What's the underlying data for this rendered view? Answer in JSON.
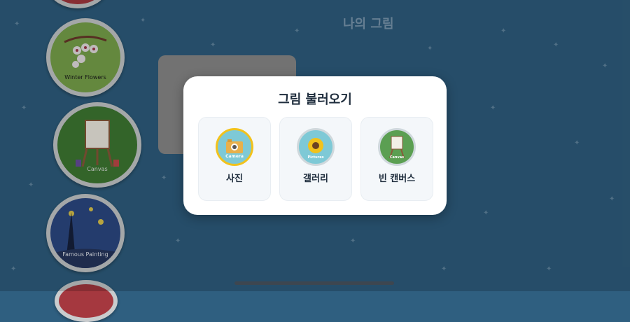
{
  "page": {
    "title": "나의 그림"
  },
  "categories": [
    {
      "label": "Winter Flowers",
      "icon": "winter-flowers-icon"
    },
    {
      "label": "Canvas",
      "icon": "canvas-easel-icon"
    },
    {
      "label": "Famous Painting",
      "icon": "starry-night-icon"
    }
  ],
  "modal": {
    "title": "그림 불러오기",
    "options": [
      {
        "label": "사진",
        "icon_text": "Camera",
        "icon": "camera-icon",
        "ring_color": "#f2c21b",
        "fill_color": "#7ec9d6"
      },
      {
        "label": "갤러리",
        "icon_text": "Pictures",
        "icon": "sunflower-icon",
        "ring_color": "#cfd8dc",
        "fill_color": "#7ec9d6"
      },
      {
        "label": "빈 캔버스",
        "icon_text": "Canvas",
        "icon": "canvas-easel-icon",
        "ring_color": "#cfd8dc",
        "fill_color": "#5b9f52"
      }
    ]
  },
  "colors": {
    "background": "#2f5f80",
    "modal": "#ffffff",
    "title": "#1f2d3d"
  }
}
